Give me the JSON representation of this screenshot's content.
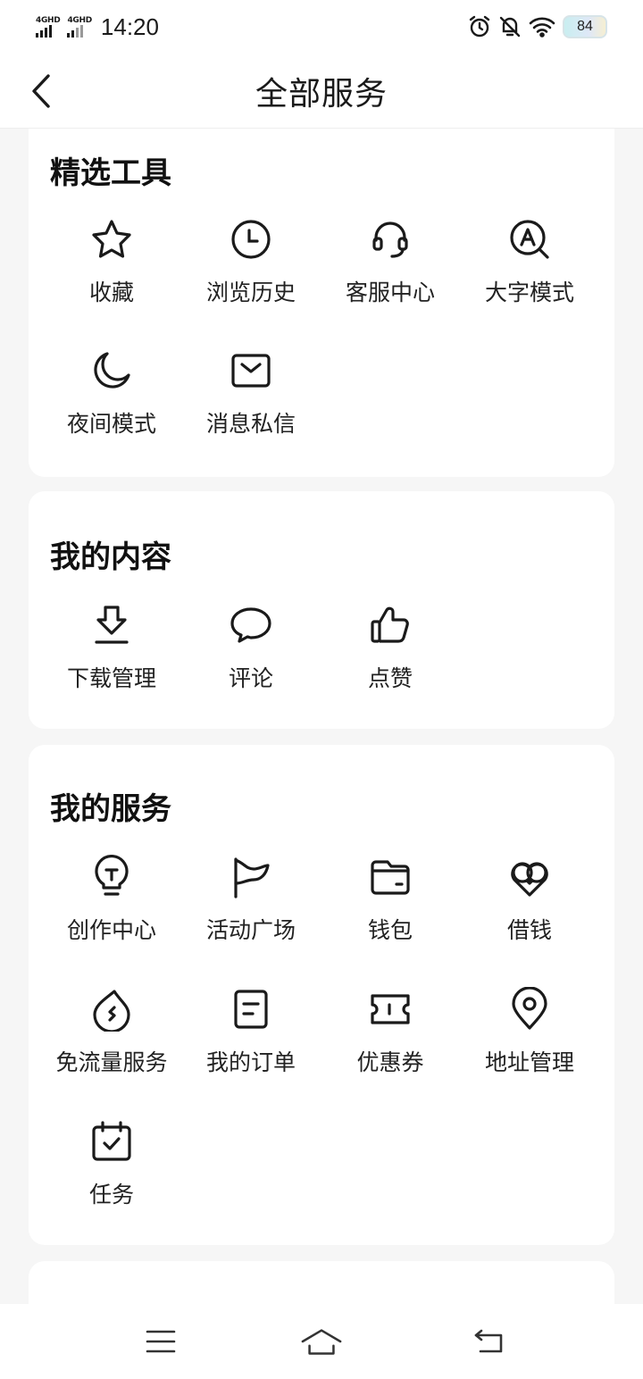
{
  "status_bar": {
    "signal_1": "4GHD",
    "signal_2": "4GHD",
    "time": "14:20",
    "battery": "84",
    "icons": [
      "alarm-icon",
      "mute-bell-icon",
      "wifi-icon",
      "battery-icon"
    ]
  },
  "nav": {
    "title": "全部服务",
    "back_icon": "back-arrow-icon"
  },
  "sections": [
    {
      "title": "精选工具",
      "items": [
        {
          "label": "收藏",
          "icon": "star-icon"
        },
        {
          "label": "浏览历史",
          "icon": "clock-icon"
        },
        {
          "label": "客服中心",
          "icon": "headset-icon"
        },
        {
          "label": "大字模式",
          "icon": "font-search-icon"
        },
        {
          "label": "夜间模式",
          "icon": "moon-icon"
        },
        {
          "label": "消息私信",
          "icon": "mail-icon"
        }
      ]
    },
    {
      "title": "我的内容",
      "items": [
        {
          "label": "下载管理",
          "icon": "download-icon"
        },
        {
          "label": "评论",
          "icon": "comment-icon"
        },
        {
          "label": "点赞",
          "icon": "thumb-up-icon"
        }
      ]
    },
    {
      "title": "我的服务",
      "items": [
        {
          "label": "创作中心",
          "icon": "lightbulb-icon"
        },
        {
          "label": "活动广场",
          "icon": "flag-icon"
        },
        {
          "label": "钱包",
          "icon": "wallet-icon"
        },
        {
          "label": "借钱",
          "icon": "heart-coin-icon"
        },
        {
          "label": "免流量服务",
          "icon": "data-drop-icon"
        },
        {
          "label": "我的订单",
          "icon": "order-doc-icon"
        },
        {
          "label": "优惠券",
          "icon": "coupon-icon"
        },
        {
          "label": "地址管理",
          "icon": "location-pin-icon"
        },
        {
          "label": "任务",
          "icon": "calendar-check-icon"
        }
      ]
    }
  ],
  "bottom_nav": [
    "menu-icon",
    "home-icon",
    "return-icon"
  ],
  "colors": {
    "background": "#f6f6f6",
    "card": "#ffffff",
    "text": "#1a1a1a",
    "icon_stroke": "#1a1a1a"
  }
}
